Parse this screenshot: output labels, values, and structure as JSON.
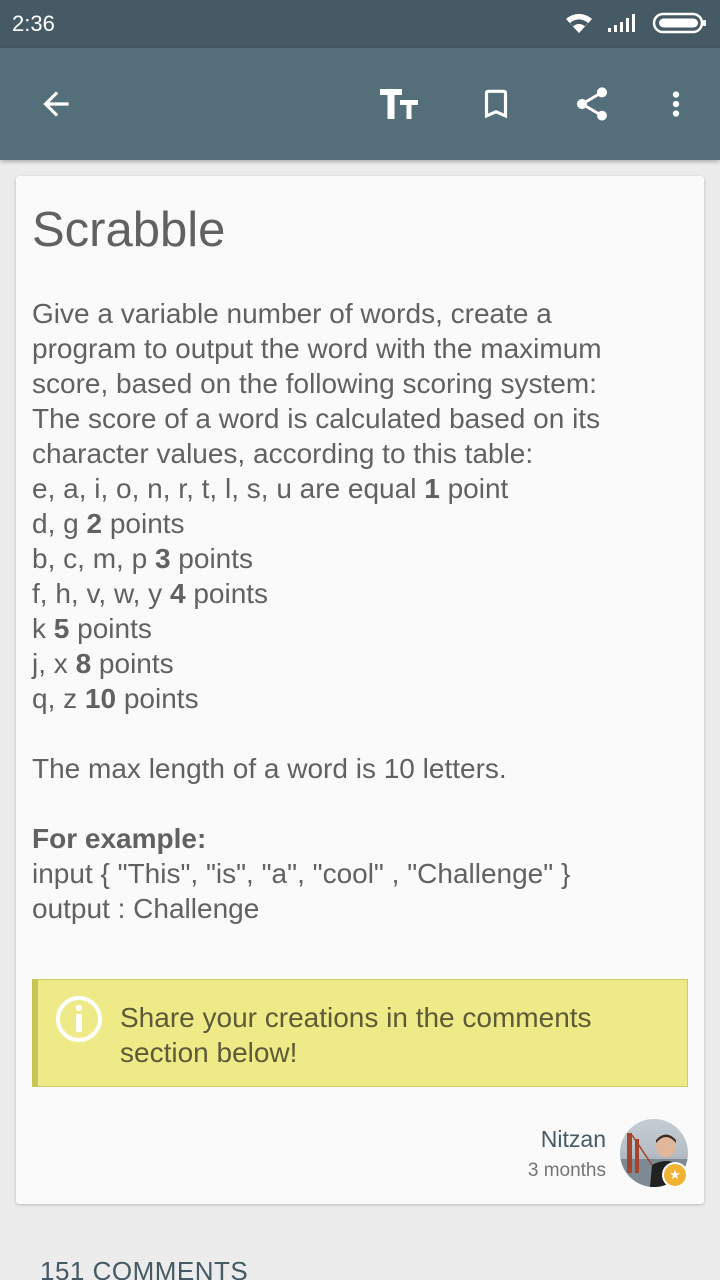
{
  "status_bar": {
    "time": "2:36"
  },
  "icons": {
    "back": "arrow-left-icon",
    "text_size": "text-size-icon",
    "bookmark": "bookmark-icon",
    "share": "share-icon",
    "more": "more-vert-icon",
    "info": "info-icon",
    "wifi": "wifi-icon",
    "signal": "signal-icon",
    "battery": "battery-icon"
  },
  "colors": {
    "status_bar": "#455a64",
    "app_bar": "#546e7a",
    "info_box": "#eeea88",
    "info_border": "#c7c553",
    "badge": "#f2b233"
  },
  "article": {
    "title": "Scrabble",
    "intro_lines": [
      "Give a variable number of words, create a",
      "program to output the word with the maximum",
      "score, based on the following scoring system:",
      "The score of a word is calculated based on its",
      "character values, according to this table:"
    ],
    "score_rows": [
      {
        "letters": "e, a, i, o, n, r, t, l, s, u are equal ",
        "value": "1",
        "unit": " point"
      },
      {
        "letters": "d, g  ",
        "value": "2",
        "unit": " points"
      },
      {
        "letters": "b, c, m, p ",
        "value": "3",
        "unit": " points"
      },
      {
        "letters": "f, h, v, w, y ",
        "value": "4",
        "unit": " points"
      },
      {
        "letters": "k ",
        "value": "5",
        "unit": " points"
      },
      {
        "letters": "j, x ",
        "value": "8",
        "unit": " points"
      },
      {
        "letters": "q, z ",
        "value": "10",
        "unit": " points"
      }
    ],
    "max_length": "The max length of a word is 10 letters.",
    "example_heading": "For example:",
    "example_input": "input { \"This\",  \"is\", \"a\", \"cool\" , \"Challenge\" }",
    "example_output": "output : Challenge"
  },
  "info_box": {
    "text": "Share your creations in the comments section below!"
  },
  "author": {
    "name": "Nitzan",
    "time": "3 months"
  },
  "comments": {
    "label": "151 COMMENTS"
  }
}
